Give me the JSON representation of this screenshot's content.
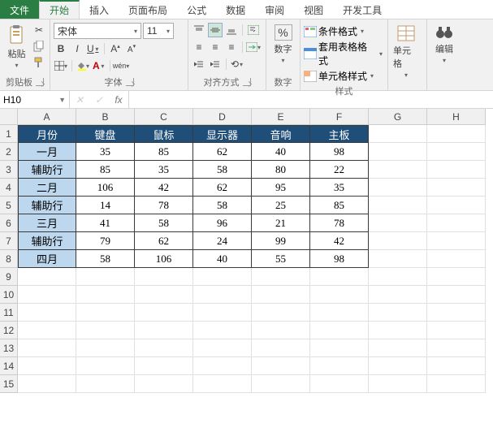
{
  "tabs": {
    "file": "文件",
    "home": "开始",
    "insert": "插入",
    "layout": "页面布局",
    "formula": "公式",
    "data": "数据",
    "review": "审阅",
    "view": "视图",
    "dev": "开发工具"
  },
  "ribbon": {
    "clipboard": {
      "paste": "粘贴",
      "label": "剪贴板"
    },
    "font": {
      "name": "宋体",
      "size": "11",
      "label": "字体",
      "bold": "B",
      "italic": "I",
      "underline": "U",
      "phonetic": "wén"
    },
    "align": {
      "label": "对齐方式"
    },
    "number": {
      "btn": "数字",
      "pct": "%",
      "label": "数字"
    },
    "styles": {
      "cond": "条件格式",
      "tfmt": "套用表格格式",
      "cfmt": "单元格样式",
      "label": "样式"
    },
    "cells": {
      "btn": "单元格"
    },
    "edit": {
      "btn": "编辑"
    }
  },
  "namebox": "H10",
  "fx": "fx",
  "cols": [
    "A",
    "B",
    "C",
    "D",
    "E",
    "F",
    "G",
    "H"
  ],
  "rows": [
    "1",
    "2",
    "3",
    "4",
    "5",
    "6",
    "7",
    "8",
    "9",
    "10",
    "11",
    "12",
    "13",
    "14",
    "15"
  ],
  "chart_data": {
    "type": "table",
    "headers": [
      "月份",
      "键盘",
      "鼠标",
      "显示器",
      "音响",
      "主板"
    ],
    "rows": [
      {
        "label": "一月",
        "values": [
          35,
          85,
          62,
          40,
          98
        ]
      },
      {
        "label": "辅助行",
        "values": [
          85,
          35,
          58,
          80,
          22
        ]
      },
      {
        "label": "二月",
        "values": [
          106,
          42,
          62,
          95,
          35
        ]
      },
      {
        "label": "辅助行",
        "values": [
          14,
          78,
          58,
          25,
          85
        ]
      },
      {
        "label": "三月",
        "values": [
          41,
          58,
          96,
          21,
          78
        ]
      },
      {
        "label": "辅助行",
        "values": [
          79,
          62,
          24,
          99,
          42
        ]
      },
      {
        "label": "四月",
        "values": [
          58,
          106,
          40,
          55,
          98
        ]
      }
    ]
  }
}
